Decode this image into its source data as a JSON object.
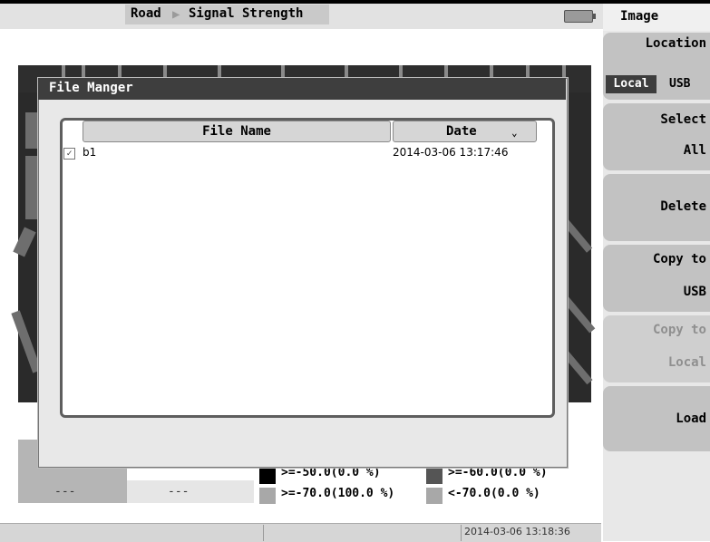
{
  "header": {
    "mode": "Road",
    "separator": "▶",
    "measurement": "Signal Strength"
  },
  "right_panel": {
    "title": "Image",
    "location_label": "Location",
    "location_options": [
      "Local",
      "USB"
    ],
    "location_selected": "Local",
    "select_label": "Select",
    "select_value": "All",
    "delete_label": "Delete",
    "copy_to_usb_label": "Copy to",
    "copy_to_usb_value": "USB",
    "copy_to_local_label": "Copy to",
    "copy_to_local_value": "Local",
    "copy_to_local_enabled": false,
    "load_label": "Load"
  },
  "dialog": {
    "title": "File Manger",
    "columns": [
      "File Name",
      "Date"
    ],
    "date_sort_indicator": "⌄",
    "files": [
      {
        "checked": true,
        "name": "b1",
        "date": "2014-03-06 13:17:46"
      }
    ]
  },
  "legend": {
    "left_values": [
      "---",
      "---"
    ],
    "partial_text": ")",
    "items": [
      {
        "label": ">=-50.0(0.0 %)",
        "color": "#000000"
      },
      {
        "label": ">=-60.0(0.0 %)",
        "color": "#555555"
      },
      {
        "label": ">=-70.0(100.0 %)",
        "color": "#a8a8a8"
      },
      {
        "label": "<-70.0(0.0 %)",
        "color": "#a8a8a8"
      }
    ]
  },
  "status_bar": {
    "time": "2014-03-06 13:18:36"
  },
  "colors": {
    "dialog_title_bg": "#3e3e3e",
    "softkey_bg": "#c2c2c2",
    "selected_segment_bg": "#3d3d3d"
  }
}
